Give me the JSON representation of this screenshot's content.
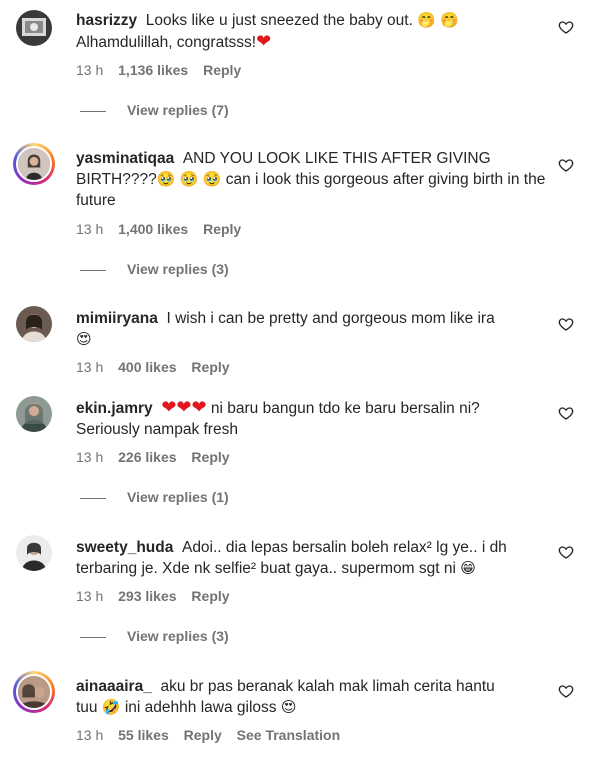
{
  "comments": [
    {
      "username": "hasrizzy",
      "text": "Looks like u just sneezed the baby out. 🤭🤭 Alhamdulillah, congratsss!❤️",
      "time": "13 h",
      "likes": "1,136 likes",
      "reply_label": "Reply",
      "view_replies": "View replies (7)"
    },
    {
      "username": "yasminatiqaa",
      "text": "AND YOU LOOK LIKE THIS AFTER GIVING BIRTH????🥹🥹🥹 can i look this gorgeous after giving birth in the future",
      "time": "13 h",
      "likes": "1,400 likes",
      "reply_label": "Reply",
      "view_replies": "View replies (3)"
    },
    {
      "username": "mimiiryana",
      "text": "I wish i can be pretty and gorgeous mom like ira 😍",
      "time": "13 h",
      "likes": "400 likes",
      "reply_label": "Reply"
    },
    {
      "username": "ekin.jamry",
      "text": "❤️❤️❤️ ni baru bangun tdo ke baru bersalin ni? Seriously nampak fresh",
      "time": "13 h",
      "likes": "226 likes",
      "reply_label": "Reply",
      "view_replies": "View replies (1)"
    },
    {
      "username": "sweety_huda",
      "text": "Adoi.. dia lepas bersalin boleh relax² lg ye.. i dh terbaring je. Xde nk selfie² buat gaya.. supermom sgt ni 😁",
      "time": "13 h",
      "likes": "293 likes",
      "reply_label": "Reply",
      "view_replies": "View replies (3)"
    },
    {
      "username": "ainaaaira_",
      "text": "aku br pas beranak kalah mak limah cerita hantu tuu 🤣 ini adehhh lawa giloss 😍",
      "time": "13 h",
      "likes": "55 likes",
      "reply_label": "Reply",
      "see_translation": "See Translation"
    }
  ],
  "icons": {
    "like": "heart-outline-icon",
    "avatar": "user-avatar"
  },
  "colors": {
    "text": "#262626",
    "secondary": "#737373",
    "heart_red": "#e0181e"
  }
}
